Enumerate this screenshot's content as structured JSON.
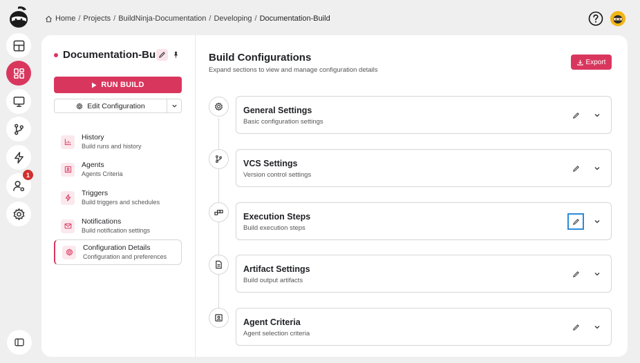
{
  "breadcrumb": {
    "items": [
      "Home",
      "Projects",
      "BuildNinja-Documentation",
      "Developing",
      "Documentation-Build"
    ]
  },
  "rail": {
    "items": [
      "dashboard-icon",
      "grid-icon",
      "monitor-icon",
      "git-branch-icon",
      "lightning-icon",
      "user-settings-icon",
      "gear-icon"
    ],
    "active": "grid-icon",
    "notification_count": "1"
  },
  "sidebar": {
    "project_title": "Documentation-Bu...",
    "run_build_label": "RUN BUILD",
    "edit_config_label": "Edit Configuration",
    "items": [
      {
        "title": "History",
        "subtitle": "Build runs and history",
        "icon": "chart-icon"
      },
      {
        "title": "Agents",
        "subtitle": "Agents Criteria",
        "icon": "agent-icon"
      },
      {
        "title": "Triggers",
        "subtitle": "Build triggers and schedules",
        "icon": "lightning-icon"
      },
      {
        "title": "Notifications",
        "subtitle": "Build notification settings",
        "icon": "mail-icon"
      },
      {
        "title": "Configuration Details",
        "subtitle": "Configuration and preferences",
        "icon": "gear-icon"
      }
    ],
    "selected": "Configuration Details"
  },
  "main": {
    "title": "Build Configurations",
    "subtitle": "Expand sections to view and manage configuration details",
    "export_label": "Export",
    "sections": [
      {
        "title": "General Settings",
        "subtitle": "Basic configuration settings",
        "icon": "gear-icon"
      },
      {
        "title": "VCS Settings",
        "subtitle": "Version control settings",
        "icon": "git-branch-icon"
      },
      {
        "title": "Execution Steps",
        "subtitle": "Build execution steps",
        "icon": "steps-icon"
      },
      {
        "title": "Artifact Settings",
        "subtitle": "Build output artifacts",
        "icon": "file-icon"
      },
      {
        "title": "Agent Criteria",
        "subtitle": "Agent selection criteria",
        "icon": "agent-icon"
      }
    ]
  },
  "colors": {
    "accent": "#d9365e",
    "focus": "#2c89d8",
    "background": "#efefef"
  }
}
